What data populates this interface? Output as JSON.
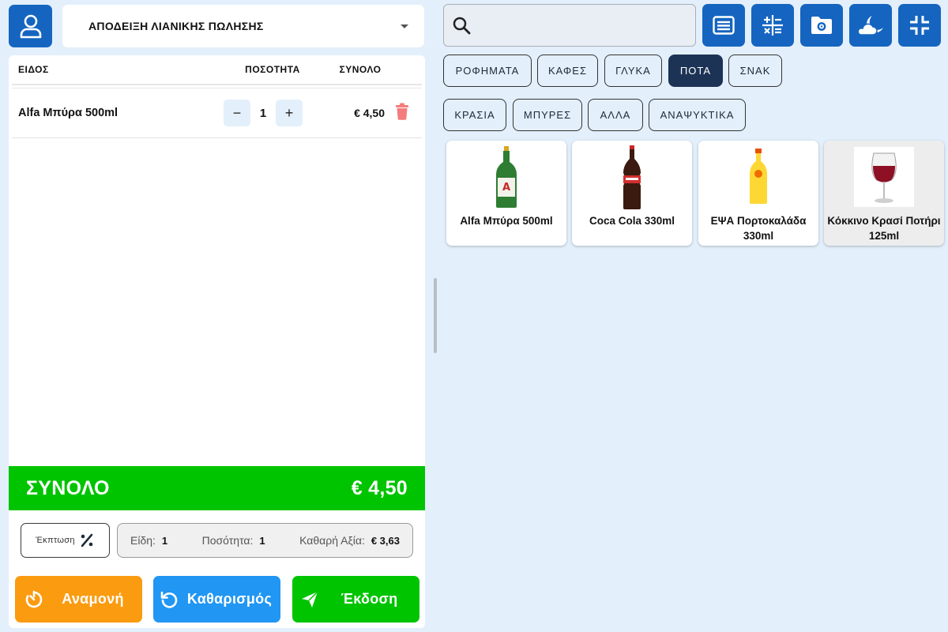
{
  "document_type": "ΑΠΟΔΕΙΞΗ ΛΙΑΝΙΚΗΣ ΠΩΛΗΣΗΣ",
  "cart": {
    "headers": {
      "item": "ΕΙΔΟΣ",
      "quantity": "ΠΟΣΟΤΗΤΑ",
      "total": "ΣΥΝΟΛΟ"
    },
    "rows": [
      {
        "name": "Alfa Μπύρα 500ml",
        "qty": "1",
        "price": "€ 4,50"
      }
    ],
    "minus": "−",
    "plus": "+"
  },
  "total": {
    "label": "ΣΥΝΟΛΟ",
    "value": "€ 4,50"
  },
  "discount_label": "Έκπτωση",
  "summary": {
    "items_label": "Είδη:",
    "items_value": "1",
    "qty_label": "Ποσότητα:",
    "qty_value": "1",
    "net_label": "Καθαρή Αξία:",
    "net_value": "€ 3,63"
  },
  "actions": {
    "wait": "Αναμονή",
    "clear": "Καθαρισμός",
    "issue": "Έκδοση"
  },
  "search": {
    "placeholder": ""
  },
  "categories_row1": [
    "ΡΟΦΗΜΑΤΑ",
    "ΚΑΦΕΣ",
    "ΓΛΥΚΑ",
    "ΠΟΤΑ",
    "ΣΝΑΚ"
  ],
  "categories_row2": [
    "ΚΡΑΣΙΑ",
    "ΜΠΥΡΕΣ",
    "ΑΛΛΑ",
    "ΑΝΑΨΥΚΤΙΚΑ"
  ],
  "active_category": "ΠΟΤΑ",
  "products": [
    {
      "name": "Alfa Μπύρα 500ml",
      "icon": "beer-bottle"
    },
    {
      "name": "Coca Cola 330ml",
      "icon": "cola-bottle"
    },
    {
      "name": "ΕΨΑ Πορτοκαλάδα 330ml",
      "icon": "orangeade-bottle"
    },
    {
      "name": "Κόκκινο Κρασί Ποτήρι 125ml",
      "icon": "wine-glass"
    }
  ],
  "colors": {
    "primary": "#1565c0",
    "total_green": "#00c400",
    "wait_orange": "#fb9b10",
    "clear_blue": "#2196f3",
    "active_category": "#1d3356",
    "trash": "#f47c7c"
  }
}
